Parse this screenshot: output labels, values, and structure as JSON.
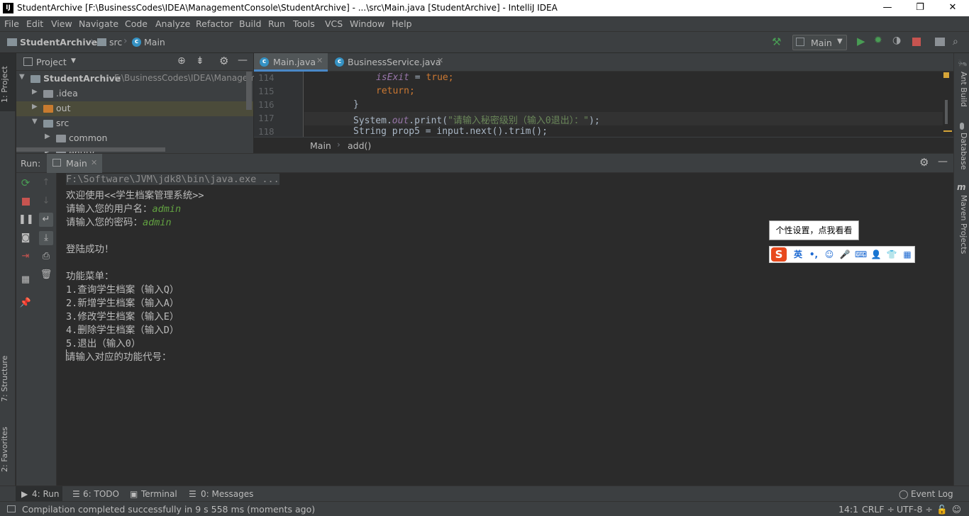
{
  "window": {
    "title": "StudentArchive [F:\\BusinessCodes\\IDEA\\ManagementConsole\\StudentArchive] - ...\\src\\Main.java [StudentArchive] - IntelliJ IDEA",
    "app_icon": "IJ",
    "minimize": "—",
    "restore": "❐",
    "close": "✕"
  },
  "menu": [
    "File",
    "Edit",
    "View",
    "Navigate",
    "Code",
    "Analyze",
    "Refactor",
    "Build",
    "Run",
    "Tools",
    "VCS",
    "Window",
    "Help"
  ],
  "navbar": {
    "project": "StudentArchive",
    "folder": "src",
    "file": "Main",
    "run_config": "Main"
  },
  "left_strip": {
    "project_tab": "1: Project",
    "structure_tab": "7: Structure",
    "favorites_tab": "2: Favorites"
  },
  "right_strip": {
    "ant": "Ant Build",
    "database": "Database",
    "maven": "Maven Projects"
  },
  "project_panel": {
    "title": "Project",
    "root_name": "StudentArchive",
    "root_path": "F:\\BusinessCodes\\IDEA\\Managem",
    "items": [
      {
        "label": "StudentArchive"
      },
      {
        "label": ".idea"
      },
      {
        "label": "out"
      },
      {
        "label": "src"
      },
      {
        "label": "common"
      },
      {
        "label": "entity"
      }
    ]
  },
  "editor": {
    "tabs": [
      {
        "label": "Main.java",
        "active": true
      },
      {
        "label": "BusinessService.java",
        "active": false
      }
    ],
    "line_numbers": [
      "114",
      "115",
      "116",
      "117",
      "118"
    ],
    "code": {
      "l114_field": "isExit",
      "l114_eq": " = ",
      "l114_kw": "true",
      "l114_end": ";",
      "l115_kw": "return",
      "l115_end": ";",
      "l116": "}",
      "l117_a": "System.",
      "l117_field": "out",
      "l117_b": ".print(",
      "l117_str": "\"请输入秘密级别（输入0退出）：\"",
      "l117_c": ");",
      "l118": "String prop5 = input.next().trim();"
    },
    "breadcrumb": [
      "Main",
      "add()"
    ]
  },
  "run_panel": {
    "label": "Run:",
    "tab": "Main",
    "console": {
      "cmd": "F:\\Software\\JVM\\jdk8\\bin\\java.exe ...",
      "welcome": "欢迎使用<<学生档案管理系统>>",
      "user_prompt": "请输入您的用户名：",
      "user_value": "admin",
      "pass_prompt": "请输入您的密码：",
      "pass_value": "admin",
      "login_ok": "登陆成功！",
      "menu_title": "功能菜单：",
      "menu_1": "1.查询学生档案（输入Q）",
      "menu_2": "2.新增学生档案（输入A）",
      "menu_3": "3.修改学生档案（输入E）",
      "menu_4": "4.删除学生档案（输入D）",
      "menu_5": "5.退出（输入0）",
      "final_prompt": "请输入对应的功能代号："
    }
  },
  "ime": {
    "tip": "个性设置，点我看看",
    "lang": "英",
    "punct": "•,"
  },
  "bottom_tabs": [
    {
      "label": "4: Run"
    },
    {
      "label": "6: TODO"
    },
    {
      "label": "Terminal"
    },
    {
      "label": "0: Messages"
    }
  ],
  "event_log": "Event Log",
  "status": {
    "message": "Compilation completed successfully in 9 s 558 ms (moments ago)",
    "position": "14:1",
    "line_sep": "CRLF ÷",
    "encoding": "UTF-8 ÷"
  },
  "colors": {
    "accent": "#4a88c7",
    "run_green": "#499c54",
    "stop_red": "#c75450",
    "console_green": "#62a241"
  }
}
